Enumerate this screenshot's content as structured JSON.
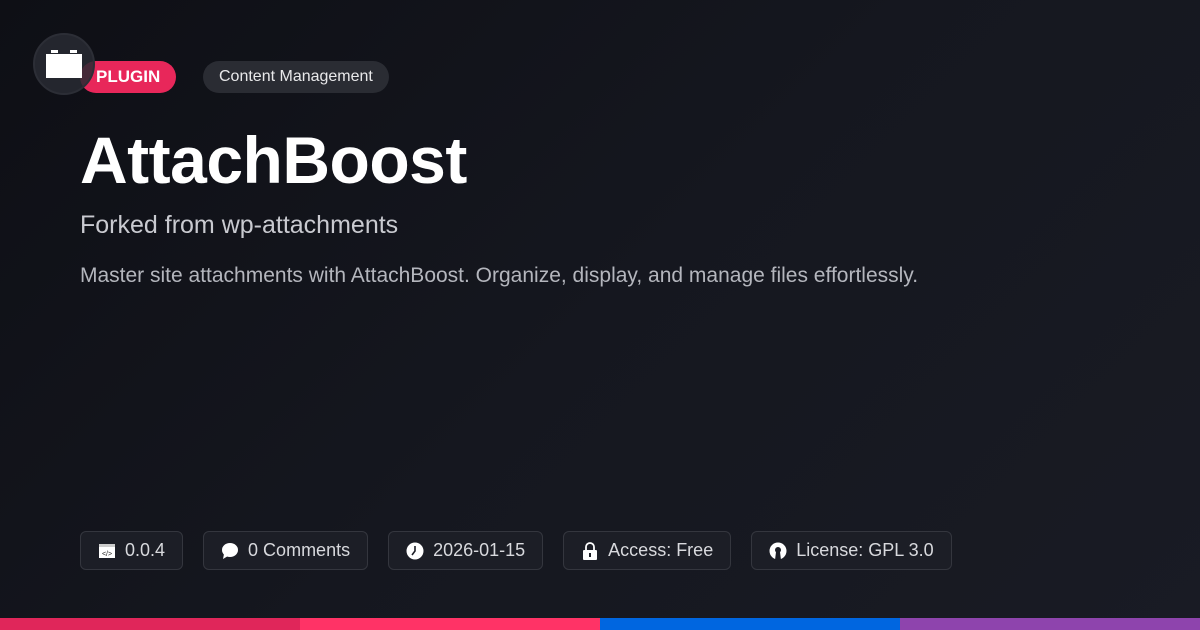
{
  "badges": {
    "type": "PLUGIN",
    "category": "Content Management"
  },
  "title": "AttachBoost",
  "subtitle": "Forked from wp-attachments",
  "description": "Master site attachments with AttachBoost. Organize, display, and manage files effortlessly.",
  "meta": [
    {
      "icon": "code-icon",
      "label": "0.0.4"
    },
    {
      "icon": "comment-icon",
      "label": "0 Comments"
    },
    {
      "icon": "clock-icon",
      "label": "2026-01-15"
    },
    {
      "icon": "lock-icon",
      "label": "Access: Free"
    },
    {
      "icon": "open-source-icon",
      "label": "License: GPL 3.0"
    }
  ],
  "colors": {
    "bar1": "#e0265a",
    "bar2": "#ff3366",
    "bar3": "#0066e0",
    "bar4": "#8e44ad"
  }
}
